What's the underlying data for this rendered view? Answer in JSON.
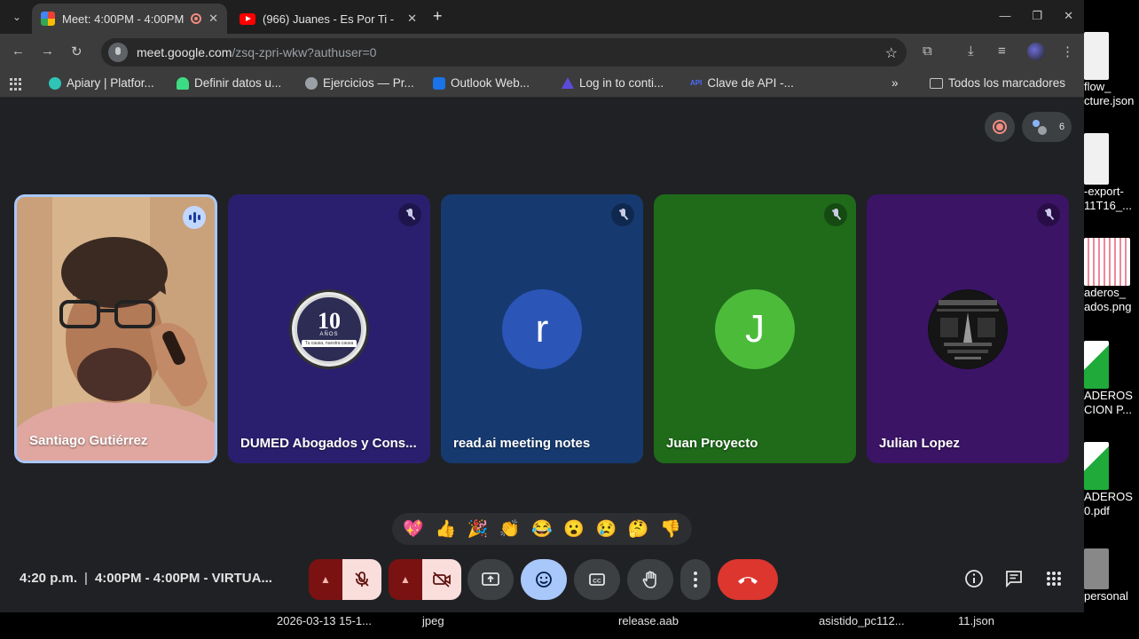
{
  "tabs": [
    {
      "title": "Meet: 4:00PM - 4:00PM",
      "active": true
    },
    {
      "title": "(966) Juanes - Es Por Ti -",
      "active": false
    }
  ],
  "omnibox": {
    "host": "meet.google.com",
    "path": "/zsq-zpri-wkw?authuser=0"
  },
  "bookmarks": [
    {
      "label": "Apiary | Platfor...",
      "color": "#2ec4b6"
    },
    {
      "label": "Definir datos u...",
      "color": "#3ddc84"
    },
    {
      "label": "Ejercicios — Pr...",
      "color": "#9aa0a6"
    },
    {
      "label": "Outlook Web...",
      "color": "#1a73e8"
    },
    {
      "label": "Log in to conti...",
      "color": "#5b4bdb"
    },
    {
      "label": "Clave de API -...",
      "color": "#4a6cff"
    }
  ],
  "all_bookmarks": "Todos los marcadores",
  "api_badge": "API",
  "participants_count": "6",
  "participants": [
    {
      "name": "Santiago Gutiérrez",
      "type": "video"
    },
    {
      "name": "DUMED Abogados y Cons...",
      "type": "logo",
      "logo_num": "10",
      "logo_sub": "AÑOS",
      "logo_motto": "Tu causa, nuestra causa"
    },
    {
      "name": "read.ai meeting notes",
      "type": "initial",
      "initial": "r"
    },
    {
      "name": "Juan Proyecto",
      "type": "initial",
      "initial": "J"
    },
    {
      "name": "Julian Lopez",
      "type": "image"
    }
  ],
  "reactions": [
    "💖",
    "👍",
    "🎉",
    "👏",
    "😂",
    "😮",
    "😢",
    "🤔",
    "👎"
  ],
  "meeting_info": {
    "time": "4:20 p.m.",
    "separator": "|",
    "title": "4:00PM - 4:00PM - VIRTUA..."
  },
  "desktop_files": [
    {
      "label1": "flow_",
      "label2": "cture.json"
    },
    {
      "label1": "-export-",
      "label2": "11T16_..."
    },
    {
      "label1": "aderos_",
      "label2": "ados.png"
    },
    {
      "label1": "ADEROS",
      "label2": "CION P..."
    },
    {
      "label1": "ADEROS",
      "label2": "0.pdf"
    },
    {
      "label1": "personal",
      "label2": ""
    }
  ],
  "taskbar": [
    "2026-03-13 15-1...",
    "jpeg",
    "release.aab",
    "asistido_pc112...",
    "11.json"
  ],
  "colors": {
    "end_call": "#dc362e",
    "active_speaker": "#a8c7fa",
    "reaction_btn": "#a8c7fa"
  }
}
